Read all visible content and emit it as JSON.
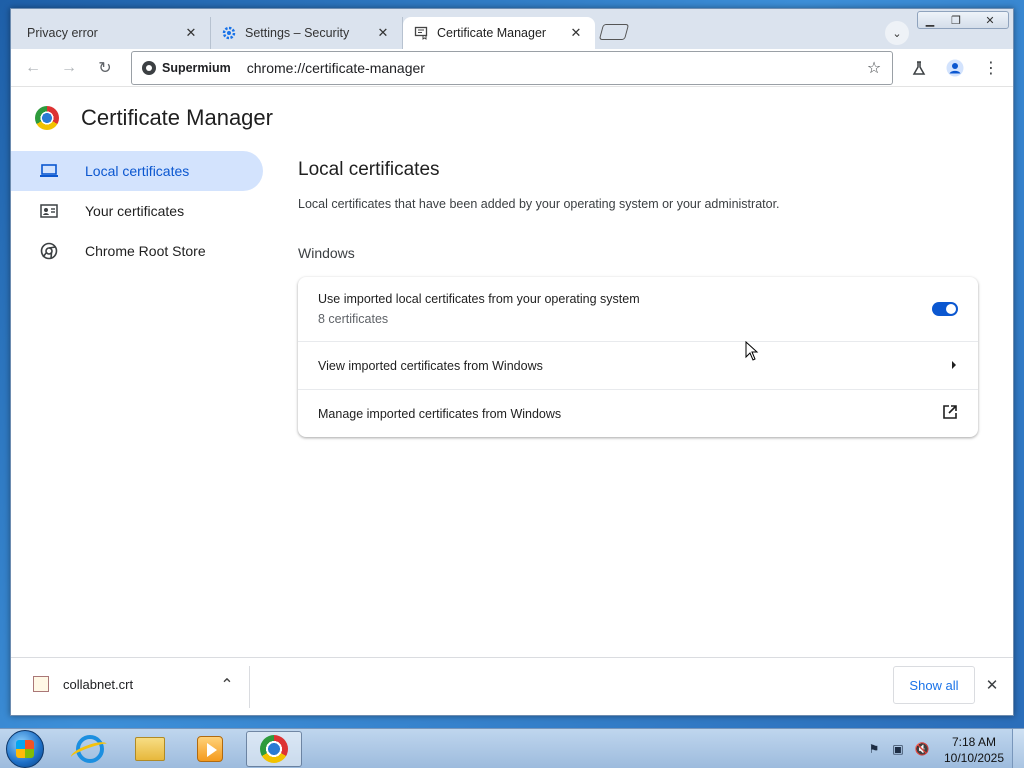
{
  "browser": {
    "tabs": [
      {
        "title": "Privacy error",
        "active": false
      },
      {
        "title": "Settings – Security",
        "active": false
      },
      {
        "title": "Certificate Manager",
        "active": true
      }
    ],
    "omnibox": {
      "chip_label": "Supermium",
      "url": "chrome://certificate-manager"
    }
  },
  "page": {
    "title": "Certificate Manager",
    "sidebar": {
      "items": [
        {
          "label": "Local certificates",
          "icon": "laptop-icon",
          "active": true
        },
        {
          "label": "Your certificates",
          "icon": "id-card-icon",
          "active": false
        },
        {
          "label": "Chrome Root Store",
          "icon": "chrome-icon",
          "active": false
        }
      ]
    },
    "main": {
      "heading": "Local certificates",
      "description": "Local certificates that have been added by your operating system or your administrator.",
      "section_label": "Windows",
      "rows": [
        {
          "label": "Use imported local certificates from your operating system",
          "sublabel": "8 certificates",
          "control": "toggle",
          "enabled": true
        },
        {
          "label": "View imported certificates from Windows",
          "control": "arrow"
        },
        {
          "label": "Manage imported certificates from Windows",
          "control": "external-link"
        }
      ]
    }
  },
  "downloads": {
    "file_name": "collabnet.crt",
    "show_all_label": "Show all"
  },
  "taskbar": {
    "time": "7:18 AM",
    "date": "10/10/2025"
  },
  "colors": {
    "accent": "#0b57d0",
    "active_nav_bg": "#d3e3fd",
    "link": "#1a73e8"
  }
}
